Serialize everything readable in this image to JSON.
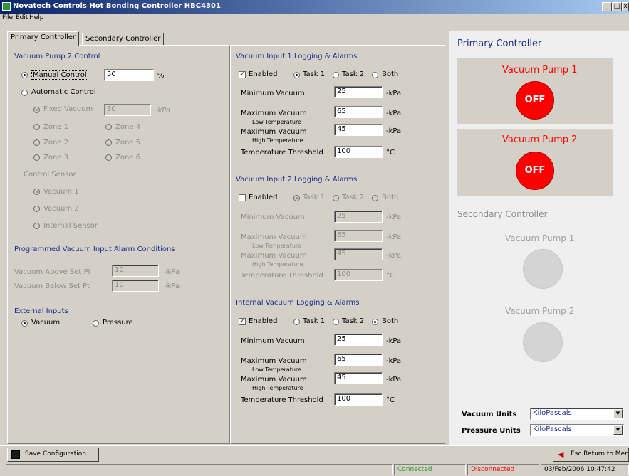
{
  "window": {
    "title": "Novatech Controls Hot Bonding Controller HBC4301",
    "min_label": "_",
    "max_label": "□",
    "close_label": "x"
  },
  "menu": [
    "File",
    "Edit",
    "Help"
  ],
  "tabs": [
    "Primary Controller",
    "Secondary Controller"
  ],
  "pump2": {
    "title": "Vacuum Pump 2 Control",
    "manual_label": "Manual Control",
    "manual_value": "50",
    "manual_unit": "%",
    "auto_label": "Automatic Control",
    "fixed_label": "Fixed Vacuum",
    "fixed_value": "30",
    "fixed_unit": "-kPa",
    "zones": [
      "Zone 1",
      "Zone 2",
      "Zone 3",
      "Zone 4",
      "Zone 5",
      "Zone 6"
    ],
    "sensor_title": "Control Sensor",
    "sensors": [
      "Vacuum 1",
      "Vacuum 2",
      "Internal Sensor"
    ]
  },
  "alarm_conditions": {
    "title": "Programmed Vacuum Input Alarm Conditions",
    "above_label": "Vacuum Above Set Pt",
    "above_value": "10",
    "below_label": "Vacuum Below Set Pt",
    "below_value": "10",
    "unit": "-kPa"
  },
  "external": {
    "title": "External Inputs",
    "vacuum_label": "Vacuum",
    "pressure_label": "Pressure"
  },
  "logging": [
    {
      "title": "Vacuum Input 1 Logging & Alarms",
      "enabled_label": "Enabled",
      "enabled": true,
      "task1": "Task 1",
      "task2": "Task 2",
      "both": "Both",
      "selected": "task1",
      "min_label": "Minimum Vacuum",
      "min_value": "25",
      "max_label": "Maximum Vacuum",
      "low_temp": "Low Temperature",
      "max_low_value": "65",
      "max_label2": "Maximum Vacuum",
      "high_temp": "High Temperature",
      "max_high_value": "45",
      "thresh_label": "Temperature Threshold",
      "thresh_value": "100",
      "kpa": "-kPa",
      "degc": "°C"
    },
    {
      "title": "Vacuum Input 2 Logging & Alarms",
      "enabled_label": "Enabled",
      "enabled": false,
      "task1": "Task 1",
      "task2": "Task 2",
      "both": "Both",
      "selected": "task1",
      "min_label": "Minimum Vacuum",
      "min_value": "25",
      "max_label": "Maximum Vacuum",
      "low_temp": "Low Temperature",
      "max_low_value": "65",
      "max_label2": "Maximum Vacuum",
      "high_temp": "High Temperature",
      "max_high_value": "45",
      "thresh_label": "Temperature Threshold",
      "thresh_value": "100",
      "kpa": "-kPa",
      "degc": "°C"
    },
    {
      "title": "Internal Vacuum Logging & Alarms",
      "enabled_label": "Enabled",
      "enabled": true,
      "task1": "Task 1",
      "task2": "Task 2",
      "both": "Both",
      "selected": "both",
      "min_label": "Minimum Vacuum",
      "min_value": "25",
      "max_label": "Maximum Vacuum",
      "low_temp": "Low Temperature",
      "max_low_value": "65",
      "max_label2": "Maximum Vacuum",
      "high_temp": "High Temperature",
      "max_high_value": "45",
      "thresh_label": "Temperature Threshold",
      "thresh_value": "100",
      "kpa": "-kPa",
      "degc": "°C"
    }
  ],
  "status_panel": {
    "primary_title": "Primary Controller",
    "pump1_label": "Vacuum Pump 1",
    "pump1_state": "OFF",
    "pump2_label": "Vacuum Pump 2",
    "pump2_state": "OFF",
    "secondary_title": "Secondary Controller",
    "sec_pump1_label": "Vacuum Pump 1",
    "sec_pump2_label": "Vacuum Pump 2",
    "vacuum_units_label": "Vacuum Units",
    "vacuum_units_value": "KiloPascals",
    "pressure_units_label": "Pressure Units",
    "pressure_units_value": "KiloPascals",
    "off_color": "#ff0000",
    "accent": "#1c2d8a"
  },
  "toolbar": {
    "save_label": "Save Configuration",
    "return_label": "Esc Return to Menu"
  },
  "statusbar": {
    "connected": "Connected",
    "disconnected": "Disconnected",
    "datetime": "03/Feb/2006  10:47:42"
  }
}
